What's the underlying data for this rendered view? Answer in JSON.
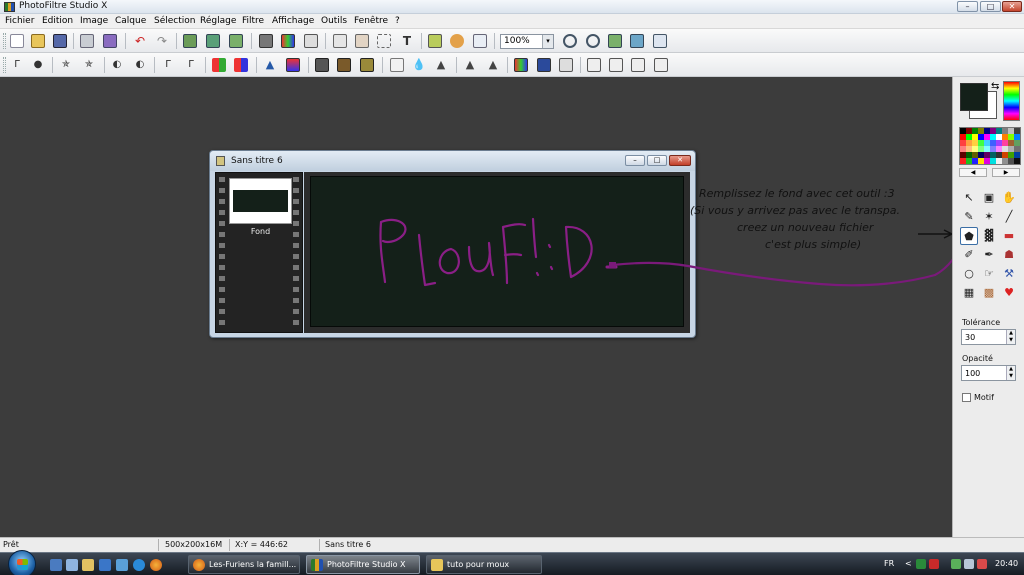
{
  "app": {
    "title": "PhotoFiltre Studio X"
  },
  "window_controls": {
    "minimize": "–",
    "maximize": "□",
    "close": "✕"
  },
  "menu": {
    "items": [
      "Fichier",
      "Edition",
      "Image",
      "Calque",
      "Sélection",
      "Réglage",
      "Filtre",
      "Affichage",
      "Outils",
      "Fenêtre",
      "?"
    ]
  },
  "toolbar": {
    "zoom_value": "100%",
    "zoom_arrow": "▾"
  },
  "document": {
    "title": "Sans titre 6",
    "layer_label": "Fond",
    "canvas_drawing_text": "Plouf! :D",
    "min": "–",
    "max": "□",
    "close": "✕"
  },
  "annotation": {
    "lines": [
      "Remplissez le fond avec cet outil :3",
      "(Si vous y arrivez pas avec le transpa.",
      "creez un nouveau fichier",
      "c'est plus simple)"
    ],
    "arrow_color": "#7a1a7a"
  },
  "colors": {
    "foreground": "#142019",
    "background": "#ffffff",
    "canvas": "#142019",
    "drawing": "#8a1f86"
  },
  "palette_arrows": {
    "left": "◀",
    "right": "▶"
  },
  "tools": [
    {
      "name": "pointer-tool-icon",
      "glyph": "↖"
    },
    {
      "name": "layer-manager-tool-icon",
      "glyph": "▣"
    },
    {
      "name": "hand-tool-icon",
      "glyph": "✋"
    },
    {
      "name": "eyedropper-tool-icon",
      "glyph": "✎"
    },
    {
      "name": "magic-wand-tool-icon",
      "glyph": "✶"
    },
    {
      "name": "line-tool-icon",
      "glyph": "╱"
    },
    {
      "name": "paint-bucket-tool-icon",
      "glyph": "⬟"
    },
    {
      "name": "spray-tool-icon",
      "glyph": "▓"
    },
    {
      "name": "eraser-tool-icon",
      "glyph": "▬"
    },
    {
      "name": "brush-tool-icon",
      "glyph": "✐"
    },
    {
      "name": "advanced-brush-tool-icon",
      "glyph": "✒"
    },
    {
      "name": "stamp-tool-icon",
      "glyph": "☗"
    },
    {
      "name": "blur-tool-icon",
      "glyph": "○"
    },
    {
      "name": "smudge-tool-icon",
      "glyph": "☞"
    },
    {
      "name": "deform-tool-icon",
      "glyph": "⚒"
    },
    {
      "name": "pattern-tool-icon",
      "glyph": "▦"
    },
    {
      "name": "image-tube-tool-icon",
      "glyph": "▩"
    },
    {
      "name": "strawberry-tool-icon",
      "glyph": "♥"
    }
  ],
  "tolerance": {
    "label": "Tolérance",
    "value": "30"
  },
  "opacity": {
    "label": "Opacité",
    "value": "100"
  },
  "motif": {
    "label": "Motif",
    "checked": false
  },
  "spinner": {
    "up": "▲",
    "down": "▼"
  },
  "status": {
    "state": "Prêt",
    "image_info": "500x200x16M",
    "coords": "X:Y = 446:62",
    "doc_name": "Sans titre 6"
  },
  "taskbar": {
    "tasks": [
      "Les-Furiens la famill...",
      "PhotoFiltre Studio X",
      "tuto pour moux"
    ],
    "language": "FR",
    "tray_arrow": "<",
    "clock": "20:40"
  }
}
